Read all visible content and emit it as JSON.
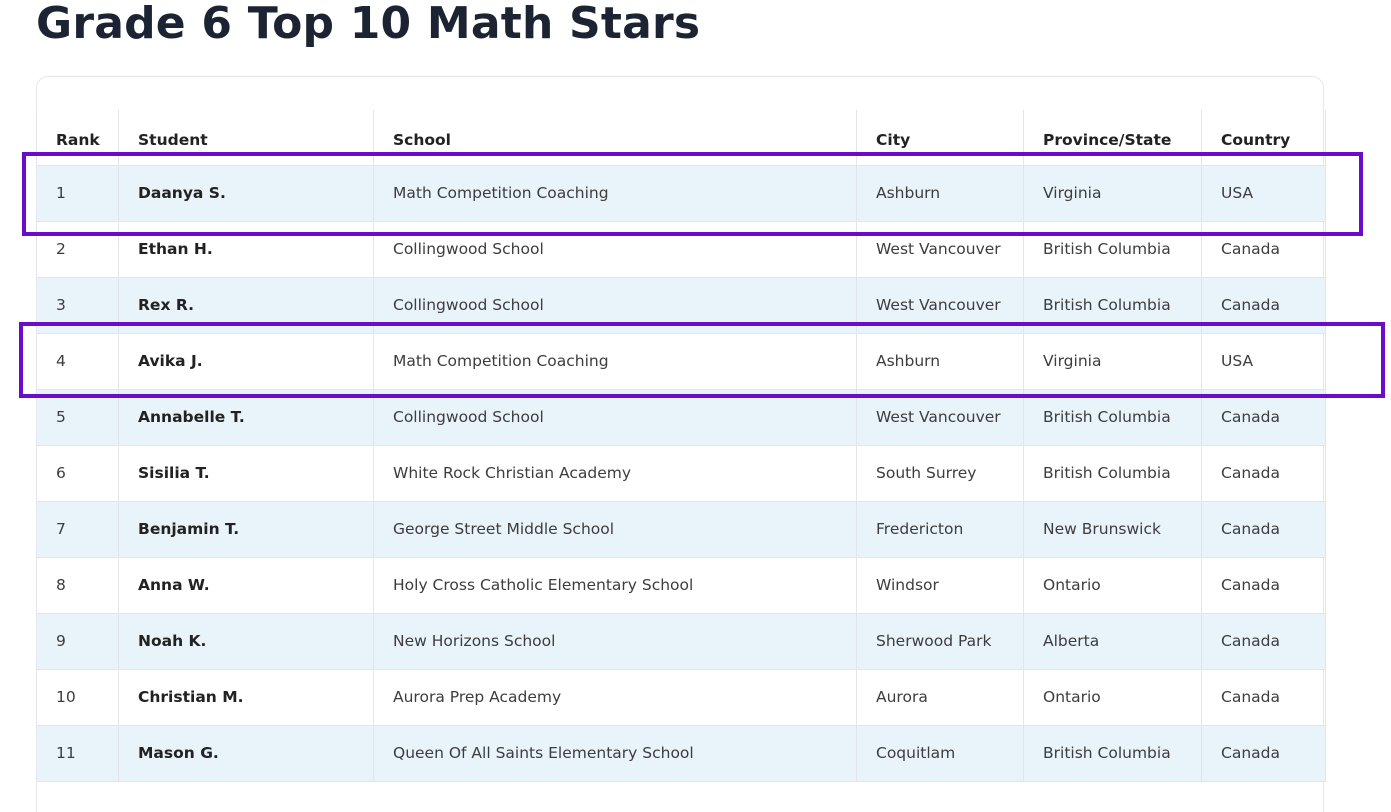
{
  "page": {
    "title": "Grade 6 Top 10 Math Stars"
  },
  "table": {
    "headers": {
      "rank": "Rank",
      "student": "Student",
      "school": "School",
      "city": "City",
      "province": "Province/State",
      "country": "Country"
    },
    "rows": [
      {
        "rank": "1",
        "student": "Daanya S.",
        "school": "Math Competition Coaching",
        "city": "Ashburn",
        "province": "Virginia",
        "country": "USA"
      },
      {
        "rank": "2",
        "student": "Ethan H.",
        "school": "Collingwood School",
        "city": "West Vancouver",
        "province": "British Columbia",
        "country": "Canada"
      },
      {
        "rank": "3",
        "student": "Rex R.",
        "school": "Collingwood School",
        "city": "West Vancouver",
        "province": "British Columbia",
        "country": "Canada"
      },
      {
        "rank": "4",
        "student": "Avika J.",
        "school": "Math Competition Coaching",
        "city": "Ashburn",
        "province": "Virginia",
        "country": "USA"
      },
      {
        "rank": "5",
        "student": "Annabelle T.",
        "school": "Collingwood School",
        "city": "West Vancouver",
        "province": "British Columbia",
        "country": "Canada"
      },
      {
        "rank": "6",
        "student": "Sisilia T.",
        "school": "White Rock Christian Academy",
        "city": "South Surrey",
        "province": "British Columbia",
        "country": "Canada"
      },
      {
        "rank": "7",
        "student": "Benjamin T.",
        "school": "George Street Middle School",
        "city": "Fredericton",
        "province": "New Brunswick",
        "country": "Canada"
      },
      {
        "rank": "8",
        "student": "Anna W.",
        "school": "Holy Cross Catholic Elementary School",
        "city": "Windsor",
        "province": "Ontario",
        "country": "Canada"
      },
      {
        "rank": "9",
        "student": "Noah K.",
        "school": "New Horizons School",
        "city": "Sherwood Park",
        "province": "Alberta",
        "country": "Canada"
      },
      {
        "rank": "10",
        "student": "Christian M.",
        "school": "Aurora Prep Academy",
        "city": "Aurora",
        "province": "Ontario",
        "country": "Canada"
      },
      {
        "rank": "11",
        "student": "Mason G.",
        "school": "Queen Of All Saints Elementary School",
        "city": "Coquitlam",
        "province": "British Columbia",
        "country": "Canada"
      }
    ]
  },
  "colors": {
    "title": "#1c2433",
    "row_shade": "#e9f3fa",
    "border": "#e2e6ea",
    "highlight_box": "#6a0dc8"
  }
}
